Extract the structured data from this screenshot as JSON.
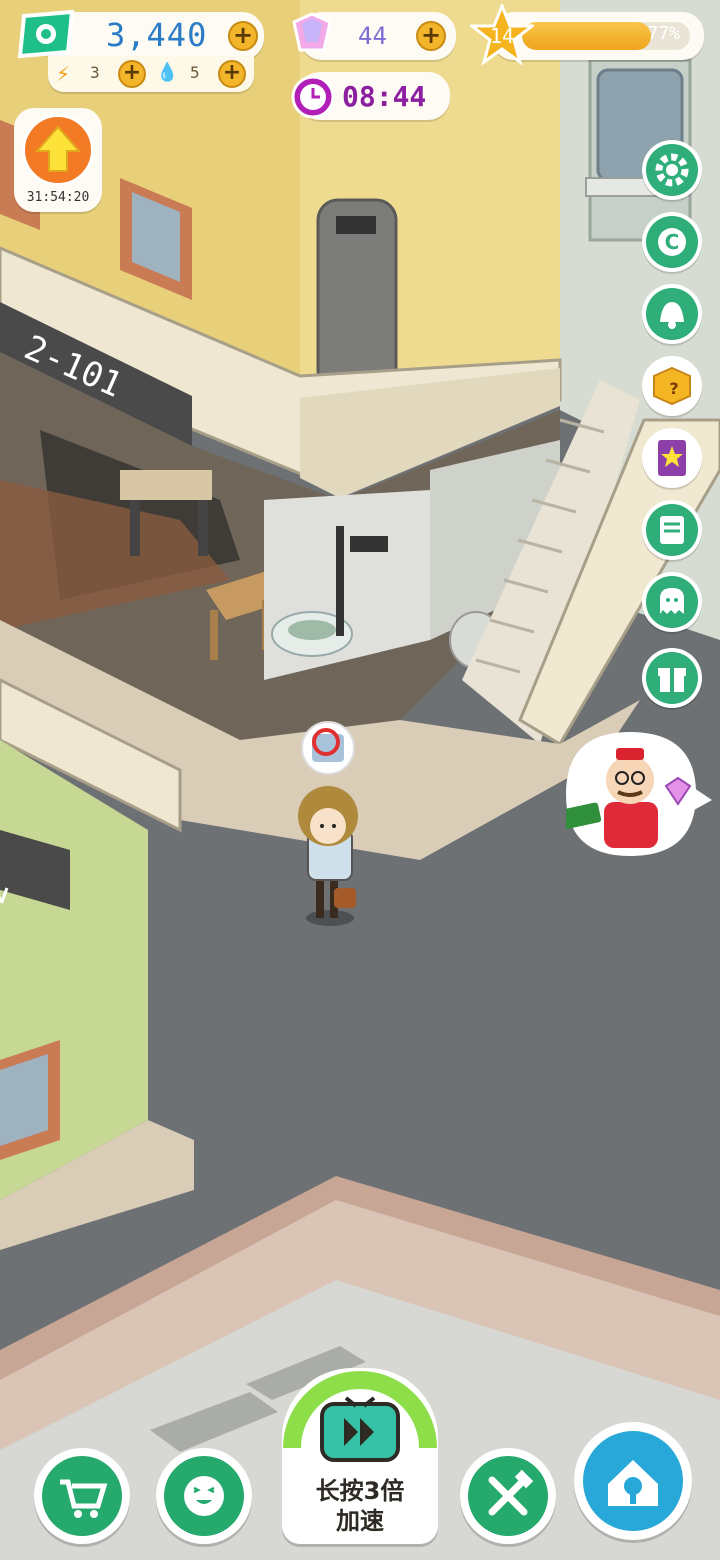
{
  "hud": {
    "cash": "3,440",
    "energy": "3",
    "water": "5",
    "gems": "44",
    "timer": "08:44",
    "level": "14",
    "xp_percent": 77,
    "xp_label": "77%",
    "boost_timer": "31:54:20"
  },
  "scene": {
    "room_sign": "2-101",
    "room_sign_partial": "2"
  },
  "bottom_nav": {
    "speed_label_line1": "长按3倍",
    "speed_label_line2": "加速"
  },
  "colors": {
    "accent_green": "#2fae7a",
    "xp_fill": "#efa41b",
    "road": "#6e7174",
    "building_yellow": "#e8cf79"
  },
  "icons": {
    "side": [
      "gear-icon",
      "coin-c-icon",
      "bell-icon",
      "mystery-box-icon",
      "star-book-icon",
      "notes-icon",
      "ghost-chat-icon",
      "gift-icon"
    ],
    "nav": [
      "cart-icon",
      "smile-face-icon",
      "tv-fast-forward-icon",
      "tools-icon",
      "home-wrench-icon"
    ]
  }
}
